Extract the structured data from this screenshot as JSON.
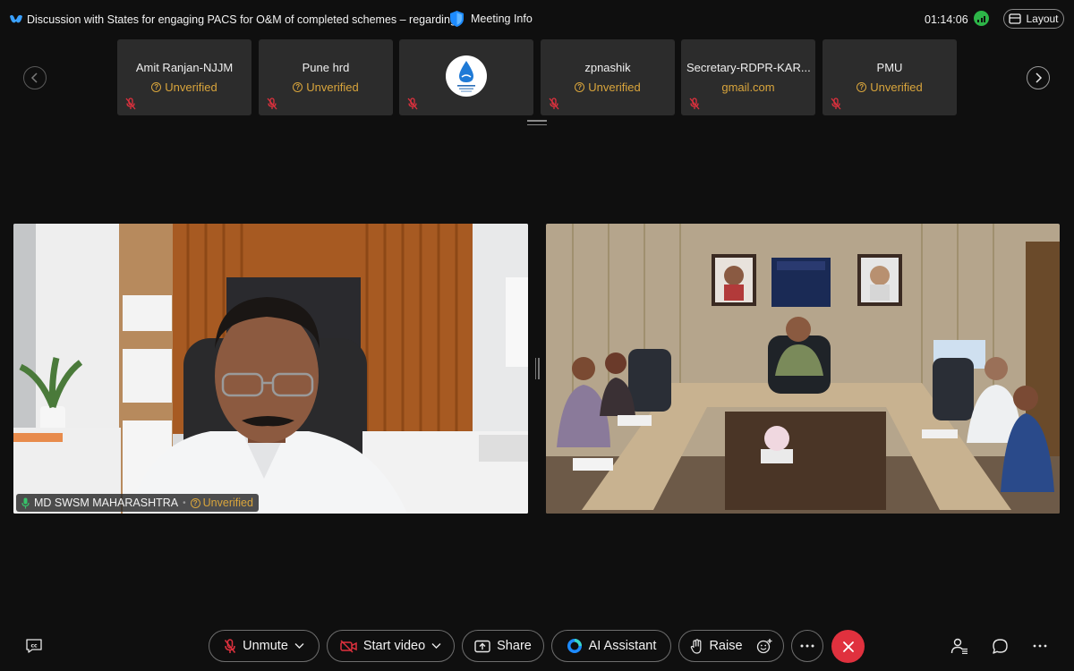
{
  "titlebar": {
    "title": "Discussion with States for engaging PACS for O&M of completed schemes – regarding.",
    "meeting_info_label": "Meeting Info",
    "timer": "01:14:06",
    "layout_label": "Layout"
  },
  "participants": [
    {
      "name": "Amit Ranjan-NJJM",
      "status": "Unverified",
      "has_badge": true
    },
    {
      "name": "Pune hrd",
      "status": "Unverified",
      "has_badge": true
    },
    {
      "name": "",
      "status": "",
      "avatar": true
    },
    {
      "name": "zpnashik",
      "status": "Unverified",
      "has_badge": true
    },
    {
      "name": "Secretary-RDPR-KAR...",
      "status": "gmail.com",
      "has_badge": false
    },
    {
      "name": "PMU",
      "status": "Unverified",
      "has_badge": true
    }
  ],
  "main_video": {
    "speaker_name": "MD SWSM MAHARASHTRA",
    "speaker_status": "Unverified"
  },
  "controls": {
    "unmute": "Unmute",
    "start_video": "Start video",
    "share": "Share",
    "ai_assistant": "AI Assistant",
    "raise": "Raise"
  },
  "colors": {
    "unverified": "#d9a53c",
    "end_call": "#e0313e",
    "signal": "#2db548",
    "muted_mic": "#e0313e"
  }
}
